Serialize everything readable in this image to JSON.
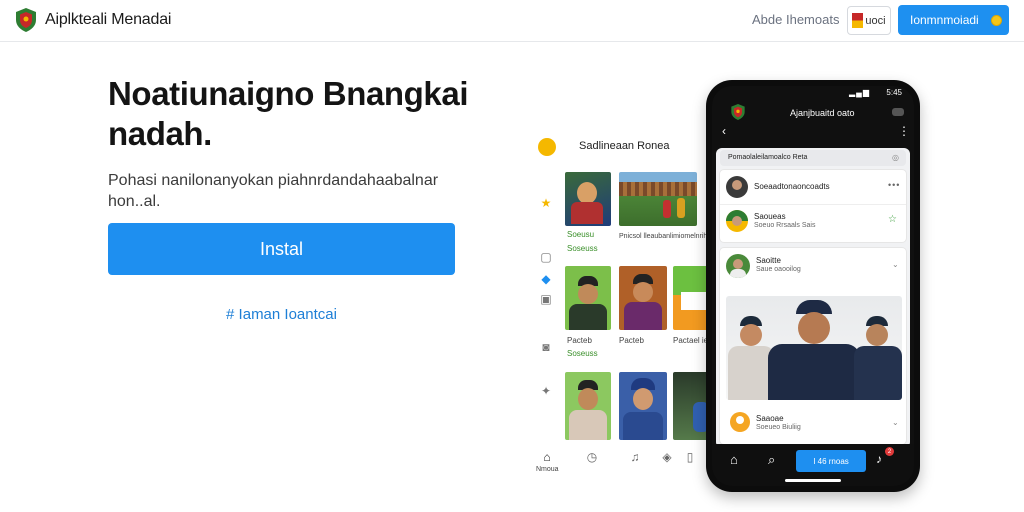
{
  "header": {
    "brand": "Aiplkteali Menadai",
    "nav_link": "Abde Ihemoats",
    "lang_label": "uoci",
    "cta_label": "Ionmnmoiadi"
  },
  "hero": {
    "title": "Noatiunaigno Bnangkai nadah.",
    "subtitle": "Pohasi nanilonanyokan piahnrdandahaabalnar hon..al.",
    "install_label": "Instal",
    "secondary_link": "# Iaman Ioantcai"
  },
  "web_panel": {
    "title": "Sadlineaan Ronea",
    "tiles": [
      {
        "caption": "Soeusu",
        "caption2": "Soseuss",
        "green": true
      },
      {
        "caption": "Pnicsol lleaubanlimiomelnrihau",
        "green": false
      },
      {
        "caption": "Pacteb",
        "caption2": "Soseuss",
        "green": true
      },
      {
        "caption": "Pacteb",
        "green": false
      },
      {
        "caption": "Pactael ieti",
        "green": false
      }
    ],
    "bottom_label": "Nmoua"
  },
  "phone": {
    "status_time": "5:45",
    "app_title": "Ajanjbuaitd oato",
    "feed_header": "Pomaolaleilamoalco Reta",
    "posts": [
      {
        "name": "Soeaadtonaoncoadts",
        "sub": ""
      },
      {
        "name": "Saoueas",
        "sub": "Soeuo Rrsaals Sais"
      },
      {
        "name": "Saoitte",
        "sub": "Saue oaooilog"
      },
      {
        "name": "Saaoae",
        "sub": "Soeueo Biuliig"
      }
    ],
    "bottom_button": "I 46 rnoas",
    "badge_count": "2"
  },
  "colors": {
    "primary": "#1e8ff0",
    "brand_green": "#2e7d32",
    "brand_red": "#c62828",
    "accent_yellow": "#f5b800"
  }
}
